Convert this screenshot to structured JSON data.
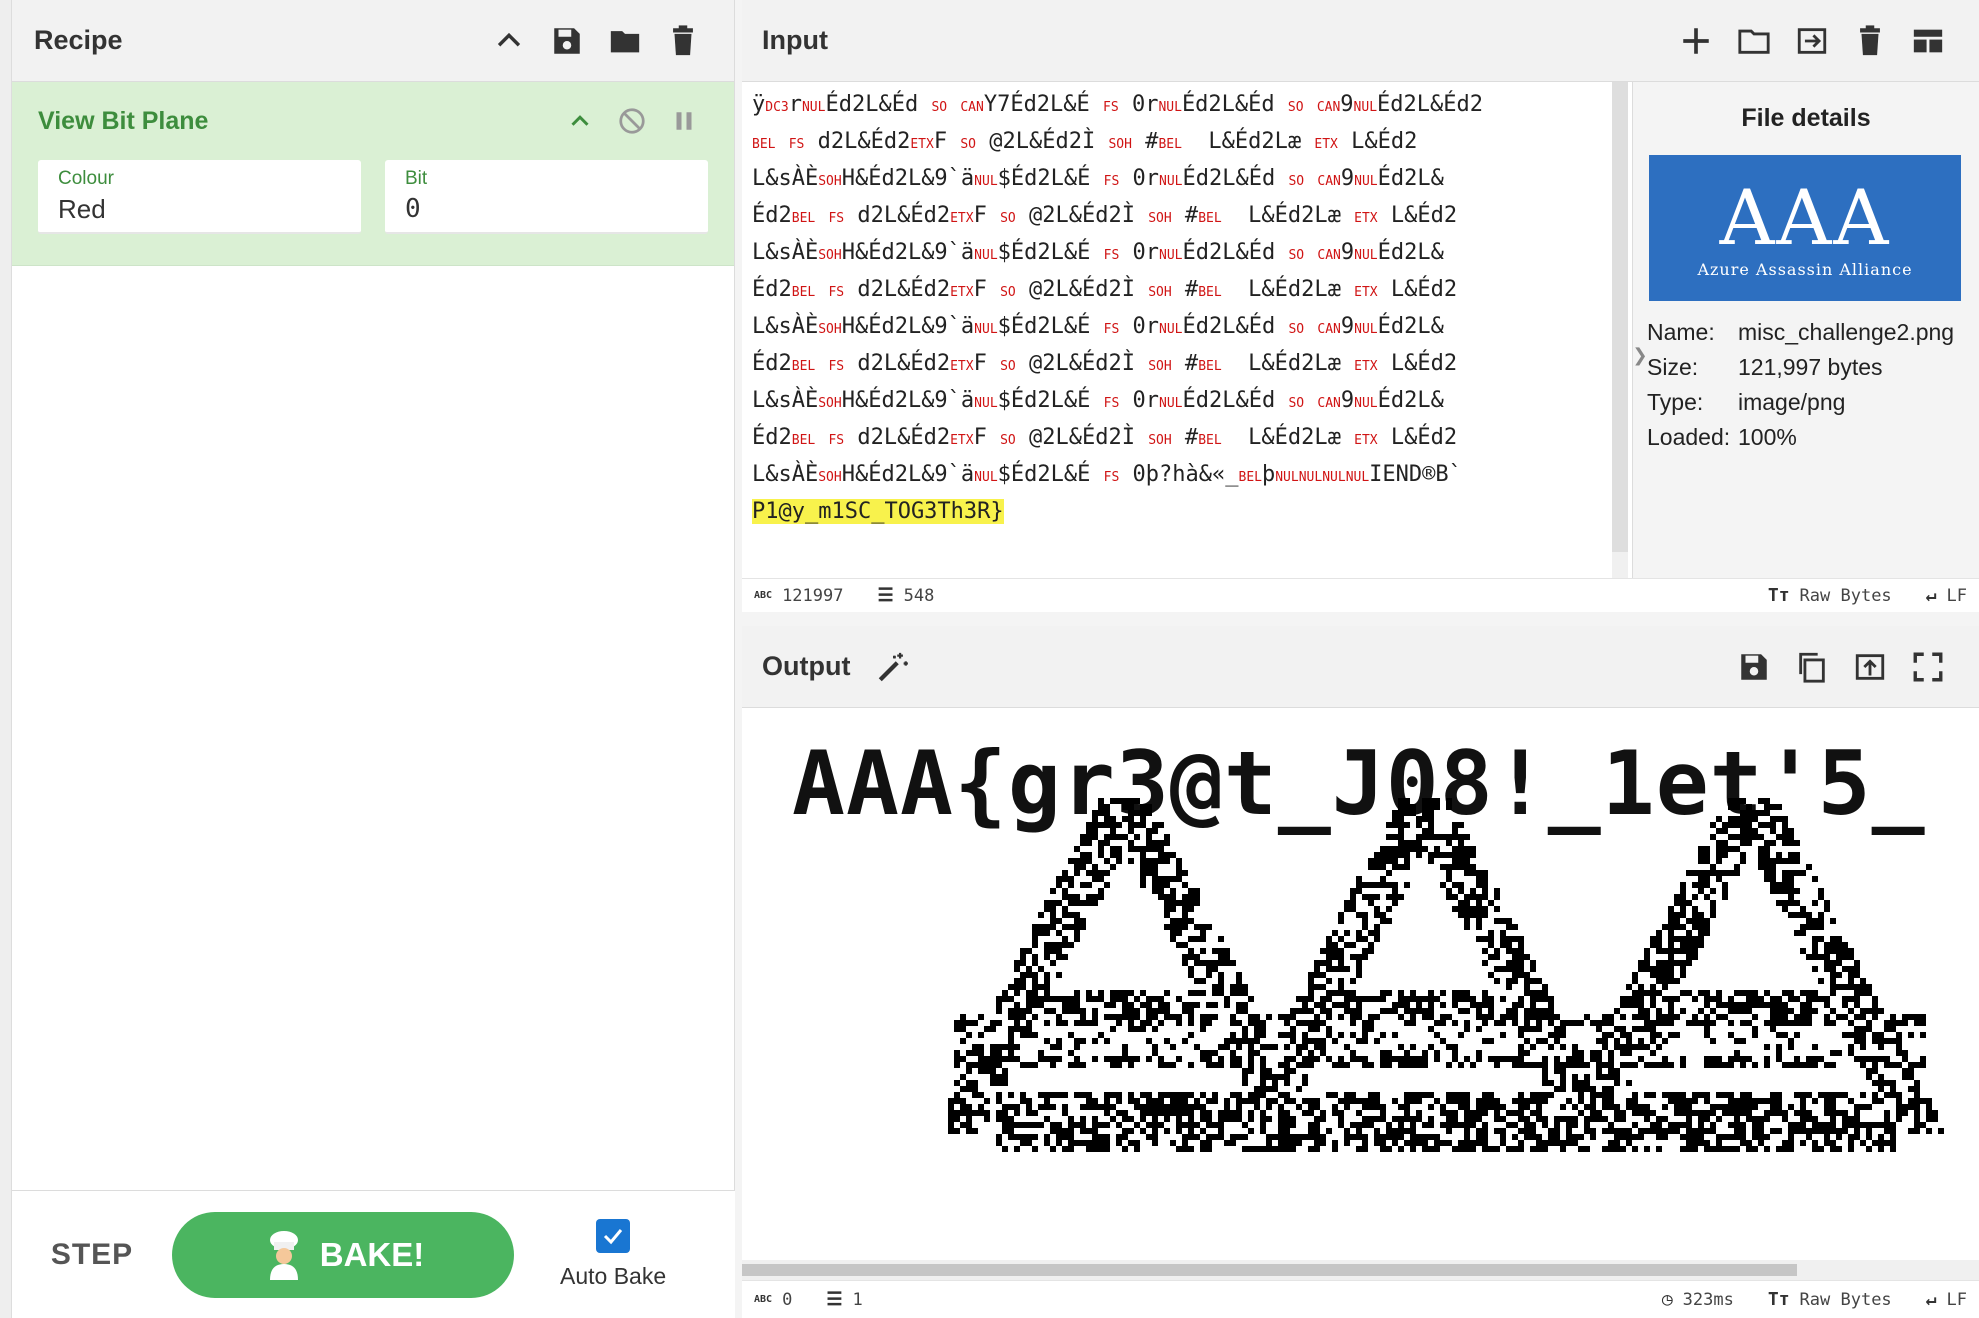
{
  "recipe": {
    "title": "Recipe",
    "operation": {
      "name": "View Bit Plane",
      "args": [
        {
          "label": "Colour",
          "value": "Red"
        },
        {
          "label": "Bit",
          "value": "0"
        }
      ]
    },
    "step_label": "STEP",
    "bake_label": "BAKE!",
    "auto_bake_label": "Auto Bake",
    "auto_bake_checked": true
  },
  "input": {
    "title": "Input",
    "lines": [
      "ÿDC3rNULÉd2L&Éd SO CANY7Éd2L&É FS 0rNULÉd2L&Éd SO CAN9NULÉd2L&Éd2",
      "BEL FS d2L&Éd2ETXF SO @2L&Éd2Ì SOH #BEL  L&Éd2Læ ETX L&Éd2",
      "L&sÀÈSOHH&Éd2L&9`äNUL$Éd2L&É FS 0rNULÉd2L&Éd SO CAN9NULÉd2L&",
      "Éd2BEL FS d2L&Éd2ETXF SO @2L&Éd2Ì SOH #BEL  L&Éd2Læ ETX L&Éd2",
      "L&sÀÈSOHH&Éd2L&9`äNUL$Éd2L&É FS 0rNULÉd2L&Éd SO CAN9NULÉd2L&",
      "Éd2BEL FS d2L&Éd2ETXF SO @2L&Éd2Ì SOH #BEL  L&Éd2Læ ETX L&Éd2",
      "L&sÀÈSOHH&Éd2L&9`äNUL$Éd2L&É FS 0rNULÉd2L&Éd SO CAN9NULÉd2L&",
      "Éd2BEL FS d2L&Éd2ETXF SO @2L&Éd2Ì SOH #BEL  L&Éd2Læ ETX L&Éd2",
      "L&sÀÈSOHH&Éd2L&9`äNUL$Éd2L&É FS 0rNULÉd2L&Éd SO CAN9NULÉd2L&",
      "Éd2BEL FS d2L&Éd2ETXF SO @2L&Éd2Ì SOH #BEL  L&Éd2Læ ETX L&Éd2",
      "L&sÀÈSOHH&Éd2L&9`äNUL$Éd2L&É FS 0þ?hà&«_BELþNULNULNULNULIEND®B`"
    ],
    "highlight_text": "P1@y_m1SC_TOG3Th3R}",
    "status": {
      "length": "121997",
      "lines": "548",
      "encoding": "Raw Bytes",
      "eol": "LF"
    }
  },
  "file_details": {
    "title": "File details",
    "thumbnail": {
      "logo": "AAA",
      "caption": "Azure Assassin Alliance"
    },
    "rows": [
      {
        "key": "Name:",
        "value": "misc_challenge2.png"
      },
      {
        "key": "Size:",
        "value": "121,997 bytes"
      },
      {
        "key": "Type:",
        "value": "image/png"
      },
      {
        "key": "Loaded:",
        "value": "100%"
      }
    ]
  },
  "output": {
    "title": "Output",
    "flag_text": "AAA{gr3@t_J08!_1et'5_",
    "status": {
      "length": "0",
      "lines": "1",
      "time": "323ms",
      "encoding": "Raw Bytes",
      "eol": "LF"
    }
  },
  "colors": {
    "accent_green": "#4bb560",
    "op_bg": "#daf0d4",
    "op_text": "#3d8d3d",
    "ctrl_red": "#d01414",
    "highlight": "#f8f24c",
    "thumb_blue": "#2d6fc0"
  }
}
